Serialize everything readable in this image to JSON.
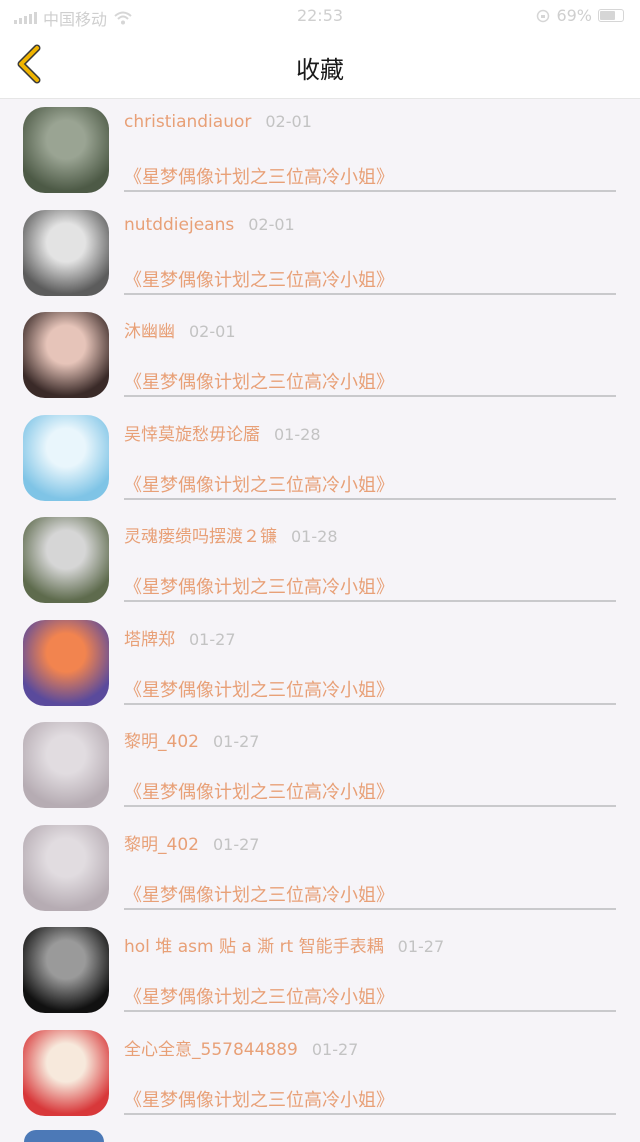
{
  "status_bar": {
    "carrier": "中国移动",
    "time": "22:53",
    "battery": "69%"
  },
  "nav": {
    "title": "收藏",
    "back_icon": "chevron-left-icon",
    "accent": "#f0b400"
  },
  "favorites": [
    {
      "user": "christiandiauor",
      "date": "02-01",
      "title": "《星梦偶像计划之三位高冷小姐》",
      "avatar_colors": [
        "#4d5a46",
        "#9aa493"
      ]
    },
    {
      "user": "nutddiejeans",
      "date": "02-01",
      "title": "《星梦偶像计划之三位高冷小姐》",
      "avatar_colors": [
        "#5c5c5c",
        "#e3e3e3"
      ]
    },
    {
      "user": "沐幽幽",
      "date": "02-01",
      "title": "《星梦偶像计划之三位高冷小姐》",
      "avatar_colors": [
        "#3a2a28",
        "#e6c4b9"
      ]
    },
    {
      "user": "吴悻莫旋愁毋论靥",
      "date": "01-28",
      "title": "《星梦偶像计划之三位高冷小姐》",
      "avatar_colors": [
        "#7fc4e6",
        "#e9f6fc"
      ]
    },
    {
      "user": "灵魂瘘缋吗摆渡２镰",
      "date": "01-28",
      "title": "《星梦偶像计划之三位高冷小姐》",
      "avatar_colors": [
        "#5e6b4d",
        "#d6d6d6"
      ]
    },
    {
      "user": "塔牌郑",
      "date": "01-27",
      "title": "《星梦偶像计划之三位高冷小姐》",
      "avatar_colors": [
        "#5a4a9c",
        "#f2844f"
      ]
    },
    {
      "user": "黎明_402",
      "date": "01-27",
      "title": "《星梦偶像计划之三位高冷小姐》",
      "avatar_colors": [
        "#b6acb3",
        "#e1dce0"
      ]
    },
    {
      "user": "黎明_402",
      "date": "01-27",
      "title": "《星梦偶像计划之三位高冷小姐》",
      "avatar_colors": [
        "#b6acb3",
        "#e1dce0"
      ]
    },
    {
      "user": "hol 堆 asm 贴 a 澌 rt 智能手表耦",
      "date": "01-27",
      "title": "《星梦偶像计划之三位高冷小姐》",
      "avatar_colors": [
        "#111111",
        "#9a9a9a"
      ]
    },
    {
      "user": "全心全意_557844889",
      "date": "01-27",
      "title": "《星梦偶像计划之三位高冷小姐》",
      "avatar_colors": [
        "#d8383a",
        "#f7e9dc"
      ]
    }
  ]
}
